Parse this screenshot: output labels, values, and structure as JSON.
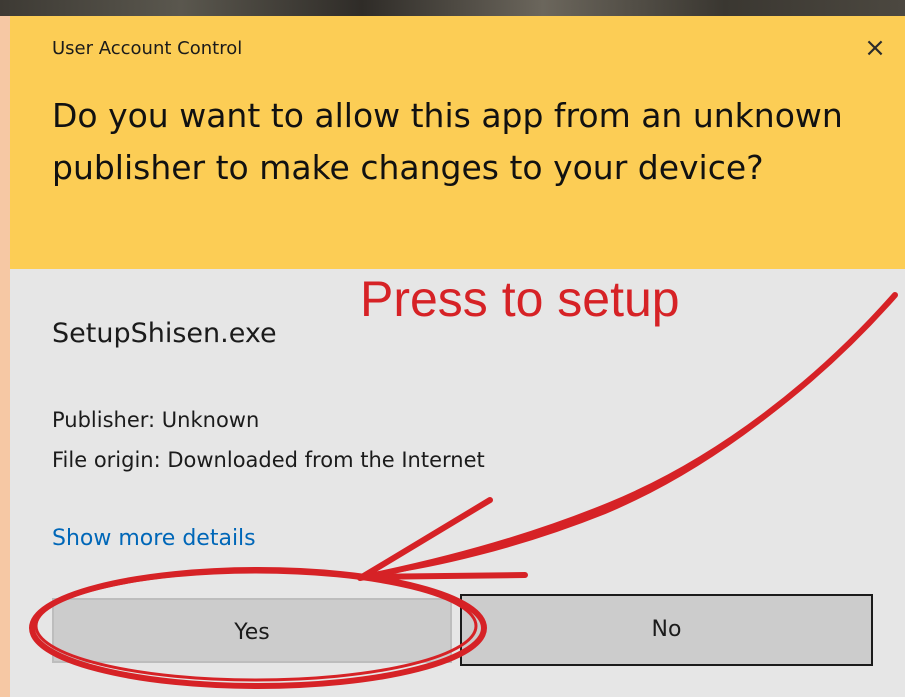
{
  "dialog": {
    "title": "User Account Control",
    "close_glyph": "×",
    "question": "Do you want to allow this app from an unknown publisher to make changes to your device?",
    "app_name": "SetupShisen.exe",
    "publisher": "Publisher: Unknown",
    "origin": "File origin: Downloaded from the Internet",
    "details_link": "Show more details",
    "yes_label": "Yes",
    "no_label": "No"
  },
  "annotation": {
    "text": "Press to setup",
    "color": "#d62226"
  },
  "colors": {
    "header": "#fccd55",
    "body": "#e6e6e6",
    "link": "#0067b8",
    "button": "#cccccc",
    "frame": "#f6c8a4"
  },
  "icons": {
    "close": "close-icon",
    "arrow": "red-arrow-annotation",
    "circle": "red-circle-annotation"
  }
}
